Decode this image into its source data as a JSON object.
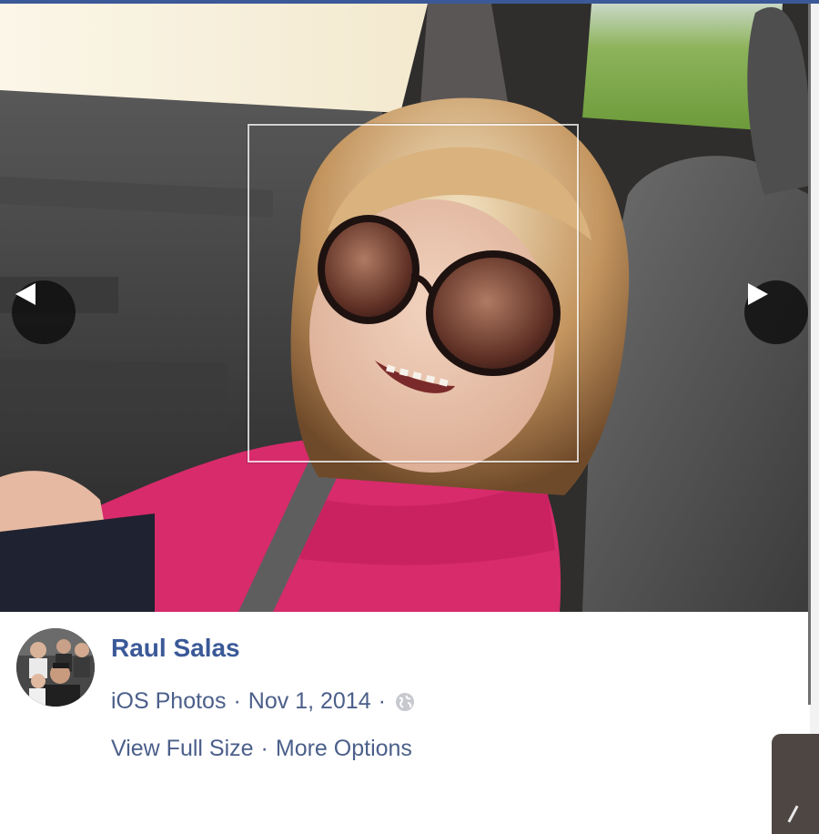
{
  "photo": {
    "subject": "photo-of-girl-in-car"
  },
  "navigation": {
    "prev_icon": "triangle-left-icon",
    "next_icon": "triangle-right-icon"
  },
  "post": {
    "owner_name": "Raul Salas",
    "source": "iOS Photos",
    "separator": "·",
    "date": "Nov 1, 2014",
    "privacy_icon": "globe-icon",
    "view_full_size": "View Full Size",
    "more_options": "More Options"
  },
  "colors": {
    "link_blue": "#3b5998",
    "meta_blue": "#4b5f8a",
    "nav_button_bg": "#0f0f0f"
  }
}
